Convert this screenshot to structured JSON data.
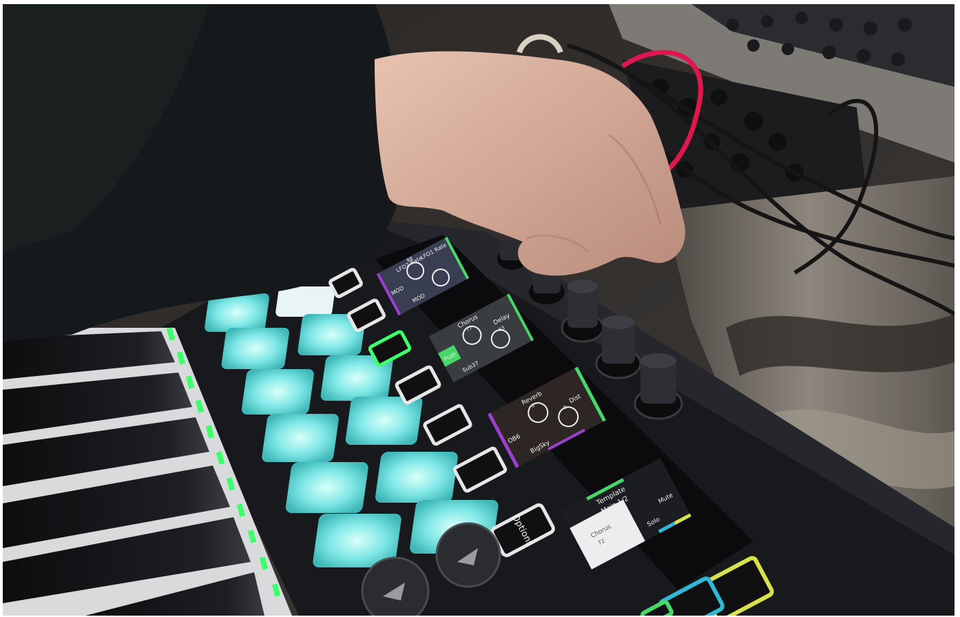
{
  "photo": {
    "description_visible": false,
    "colors": {
      "pad_cyan": "#7fe8e6",
      "led_green": "#3cff6a",
      "cable_red": "#e0174f",
      "screen_purple": "#9a3fd0",
      "screen_green": "#46d66a",
      "screen_yellow": "#d8e24a",
      "screen_blue": "#2fb8d8"
    },
    "buttons": {
      "options_label": "Options"
    },
    "screens": [
      {
        "id": "screen-1",
        "labels": [
          "LFO2 Rate",
          "LFO1 Rate",
          "MOD",
          "MOD"
        ],
        "values": [
          "88",
          ""
        ]
      },
      {
        "id": "screen-2",
        "labels": [
          "Chorus",
          "Delay",
          "Push",
          "Sub37"
        ],
        "values": [
          "77",
          "63"
        ]
      },
      {
        "id": "screen-3",
        "labels": [
          "Reverb",
          "Dist",
          "OB6",
          "BigSky"
        ],
        "values": [
          "0",
          "0"
        ]
      },
      {
        "id": "screen-4",
        "labels": [
          "Template",
          "Main 1/2",
          "Chorus",
          "Solo",
          "Mute"
        ],
        "values": [
          "72"
        ]
      }
    ]
  }
}
